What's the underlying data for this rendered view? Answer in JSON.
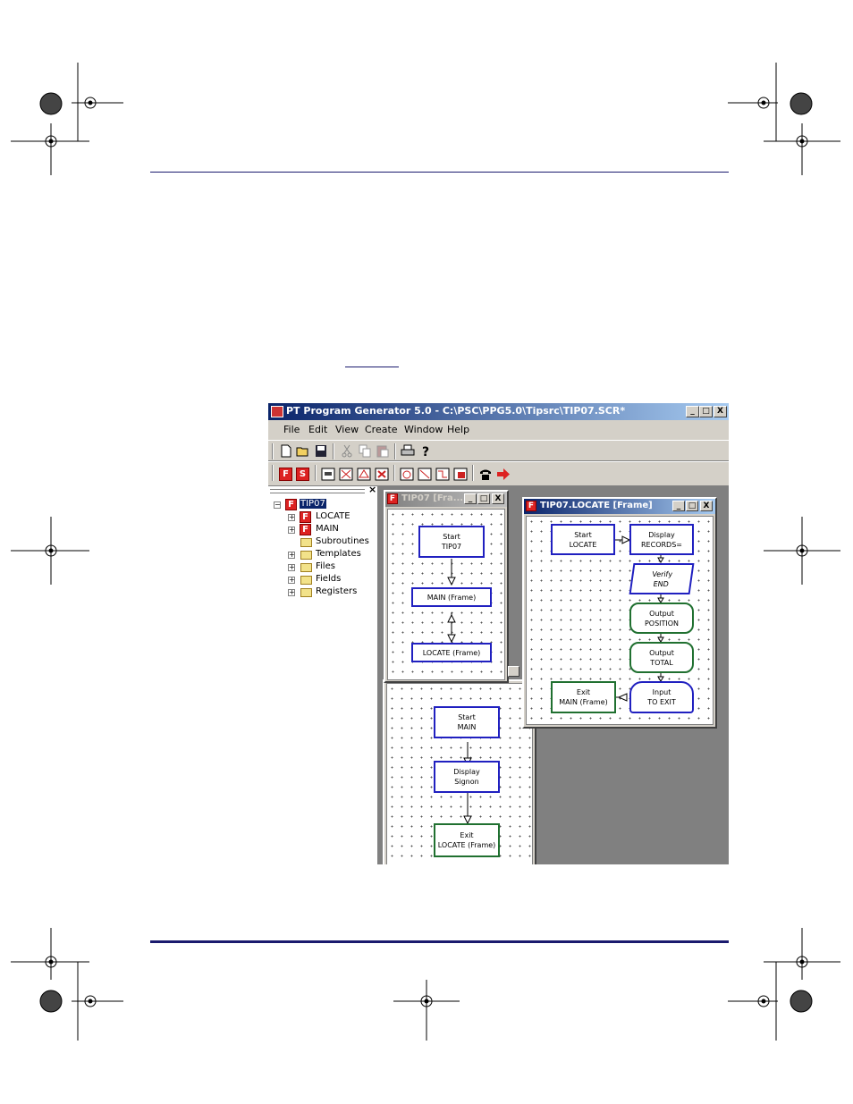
{
  "app": {
    "title": "PT Program Generator 5.0 - C:\\PSC\\PPG5.0\\Tipsrc\\TIP07.SCR*",
    "window_buttons": [
      "_",
      "□",
      "X"
    ],
    "menu": [
      "File",
      "Edit",
      "View",
      "Create",
      "Window",
      "Help"
    ]
  },
  "tree": {
    "close": "×",
    "items": [
      {
        "label": "TIP07",
        "expander": "−",
        "icon": "frame-icon",
        "selected": true
      },
      {
        "label": "LOCATE",
        "expander": "+",
        "icon": "frame-icon"
      },
      {
        "label": "MAIN",
        "expander": "+",
        "icon": "frame-icon"
      },
      {
        "label": "Subroutines",
        "expander": "",
        "icon": "folder-icon"
      },
      {
        "label": "Templates",
        "expander": "+",
        "icon": "folder-icon"
      },
      {
        "label": "Files",
        "expander": "+",
        "icon": "folder-icon"
      },
      {
        "label": "Fields",
        "expander": "+",
        "icon": "folder-icon"
      },
      {
        "label": "Registers",
        "expander": "+",
        "icon": "folder-icon"
      }
    ]
  },
  "tip07_window": {
    "title": "TIP07 [Fra...",
    "nodes": [
      {
        "l1": "Start",
        "l2": "TIP07"
      },
      {
        "l1": "MAIN (Frame)",
        "l2": ""
      },
      {
        "l1": "LOCATE (Frame)",
        "l2": ""
      }
    ]
  },
  "main_window": {
    "nodes": [
      {
        "l1": "Start",
        "l2": "MAIN"
      },
      {
        "l1": "Display",
        "l2": "Signon"
      },
      {
        "l1": "Exit",
        "l2": "LOCATE (Frame)"
      }
    ]
  },
  "locate_window": {
    "title": "TIP07.LOCATE [Frame]",
    "nodes": [
      {
        "l1": "Start",
        "l2": "LOCATE"
      },
      {
        "l1": "Display",
        "l2": "RECORDS="
      },
      {
        "l1": "Verify",
        "l2": "END"
      },
      {
        "l1": "Output",
        "l2": "POSITION"
      },
      {
        "l1": "Output",
        "l2": "TOTAL"
      },
      {
        "l1": "Input",
        "l2": "TO EXIT"
      },
      {
        "l1": "Exit",
        "l2": "MAIN (Frame)"
      }
    ]
  },
  "colors": {
    "title_bar": "#0a246a",
    "node_blue": "#2020c0",
    "node_green": "#207030",
    "rule": "#1a1a6e"
  }
}
